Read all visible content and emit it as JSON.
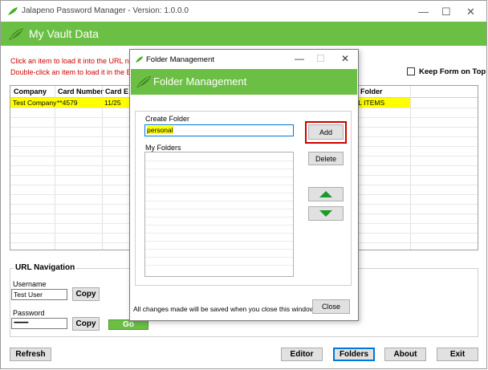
{
  "window": {
    "title": "Jalapeno Password Manager - Version: 1.0.0.0",
    "header_title": "My Vault Data",
    "minimize": "—",
    "maximize": "☐",
    "close": "✕"
  },
  "main": {
    "hint_line_1": "Click an item to load it into the URL na",
    "hint_line_2": "Double-click an item to load it in the E",
    "keep_form_on_top_label": "Keep Form on Top",
    "keep_form_on_top_checked": false,
    "table": {
      "columns": [
        "Company",
        "Card Number",
        "Card E",
        "Folder"
      ],
      "rows": [
        {
          "company": "Test Company",
          "card_number": "**4579",
          "card_exp": "11/25",
          "folder": "ALL ITEMS"
        }
      ]
    }
  },
  "url_navigation": {
    "title": "URL Navigation",
    "username_label": "Username",
    "username_value": "Test User",
    "copy_username": "Copy",
    "password_label": "Password",
    "password_value": "••••••••••••••••",
    "copy_password": "Copy",
    "go_button": "Go"
  },
  "bottom_buttons": {
    "refresh": "Refresh",
    "editor": "Editor",
    "folders": "Folders",
    "about": "About",
    "exit": "Exit"
  },
  "dialog": {
    "title": "Folder Management",
    "header_title": "Folder Management",
    "minimize": "—",
    "maximize": "☐",
    "close": "✕",
    "create_folder_label": "Create Folder",
    "create_folder_value": "personal",
    "add_button": "Add",
    "my_folders_label": "My Folders",
    "folders": [],
    "delete_button": "Delete",
    "footer_text": "All changes made will be saved when you close this window",
    "close_button": "Close"
  },
  "colors": {
    "brand_green": "#6cbf45",
    "highlight_yellow": "#ffff00",
    "hint_red": "#cc0000",
    "focus_red": "#d00000"
  },
  "icons": {
    "app_logo": "pepper-icon",
    "move_up": "triangle-up-icon",
    "move_down": "triangle-down-icon"
  }
}
